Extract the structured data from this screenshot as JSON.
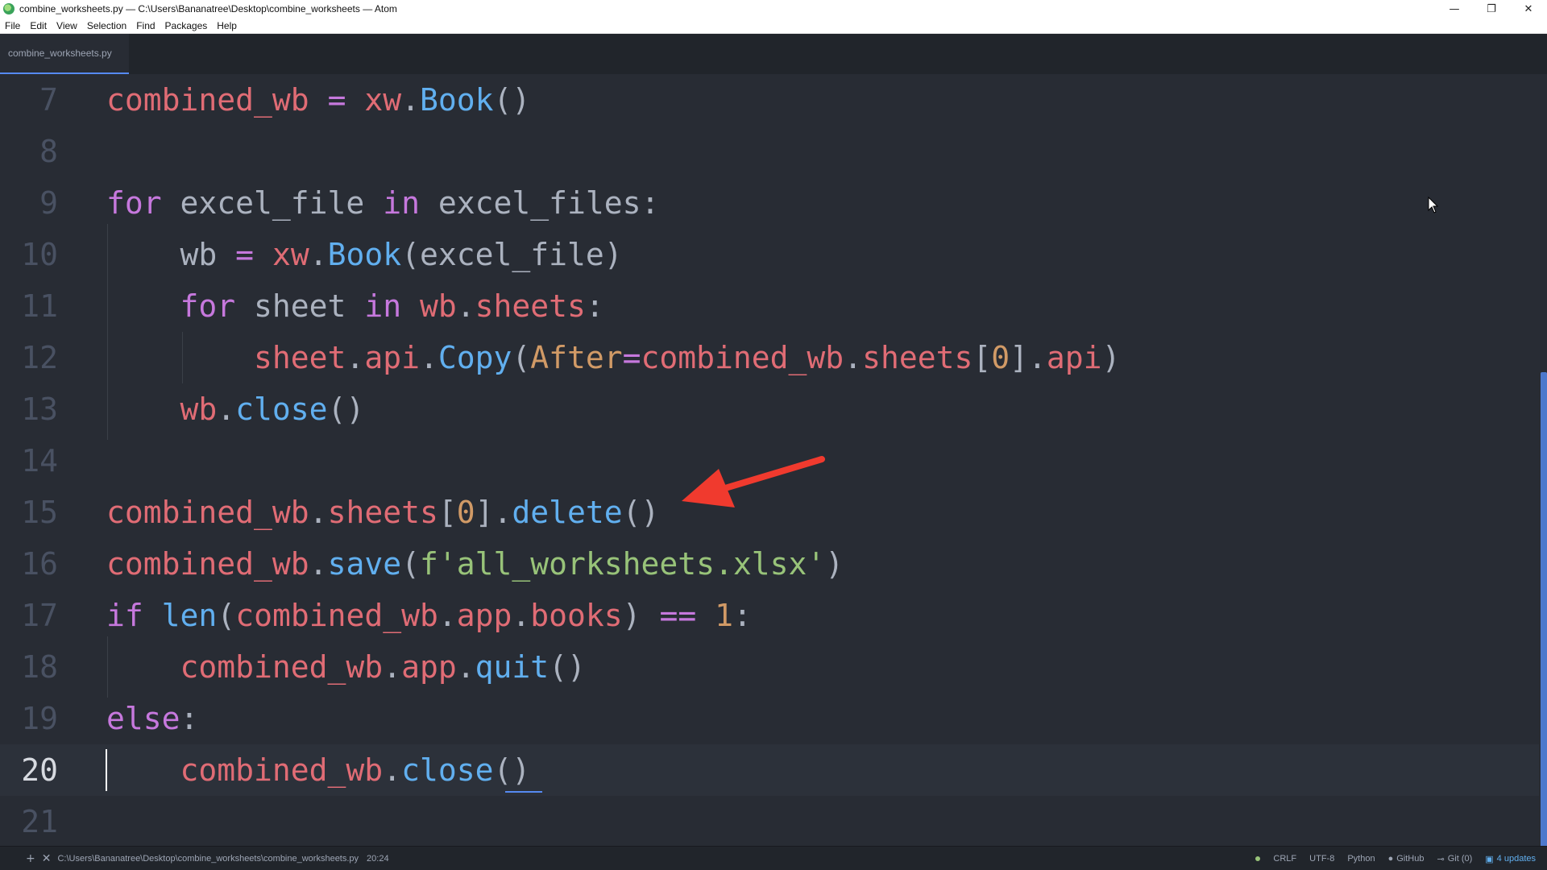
{
  "window": {
    "title": "combine_worksheets.py — C:\\Users\\Bananatree\\Desktop\\combine_worksheets — Atom",
    "minimize": "—",
    "restore": "❐",
    "close": "✕"
  },
  "menu": [
    "File",
    "Edit",
    "View",
    "Selection",
    "Find",
    "Packages",
    "Help"
  ],
  "tab": {
    "label": "combine_worksheets.py"
  },
  "editor": {
    "line_numbers": [
      "7",
      "8",
      "9",
      "10",
      "11",
      "12",
      "13",
      "14",
      "15",
      "16",
      "17",
      "18",
      "19",
      "20",
      "21"
    ],
    "active_line": "20",
    "code_tokens": {
      "l7": [
        [
          "var",
          "combined_wb"
        ],
        [
          "pl",
          " "
        ],
        [
          "op",
          "="
        ],
        [
          "pl",
          " "
        ],
        [
          "var",
          "xw"
        ],
        [
          "pl",
          "."
        ],
        [
          "fn",
          "Book"
        ],
        [
          "pl",
          "()"
        ]
      ],
      "l8": [],
      "l9": [
        [
          "kw",
          "for"
        ],
        [
          "pl",
          " excel_file "
        ],
        [
          "kw",
          "in"
        ],
        [
          "pl",
          " excel_files:"
        ]
      ],
      "l10": [
        [
          "pl",
          "    wb "
        ],
        [
          "op",
          "="
        ],
        [
          "pl",
          " "
        ],
        [
          "var",
          "xw"
        ],
        [
          "pl",
          "."
        ],
        [
          "fn",
          "Book"
        ],
        [
          "pl",
          "(excel_file)"
        ]
      ],
      "l11": [
        [
          "pl",
          "    "
        ],
        [
          "kw",
          "for"
        ],
        [
          "pl",
          " sheet "
        ],
        [
          "kw",
          "in"
        ],
        [
          "pl",
          " "
        ],
        [
          "var",
          "wb"
        ],
        [
          "pl",
          "."
        ],
        [
          "var",
          "sheets"
        ],
        [
          "pl",
          ":"
        ]
      ],
      "l12": [
        [
          "pl",
          "        "
        ],
        [
          "var",
          "sheet"
        ],
        [
          "pl",
          "."
        ],
        [
          "var",
          "api"
        ],
        [
          "pl",
          "."
        ],
        [
          "fn",
          "Copy"
        ],
        [
          "pl",
          "("
        ],
        [
          "param",
          "After"
        ],
        [
          "op",
          "="
        ],
        [
          "var",
          "combined_wb"
        ],
        [
          "pl",
          "."
        ],
        [
          "var",
          "sheets"
        ],
        [
          "pl",
          "["
        ],
        [
          "num",
          "0"
        ],
        [
          "pl",
          "]."
        ],
        [
          "var",
          "api"
        ],
        [
          "pl",
          ")"
        ]
      ],
      "l13": [
        [
          "pl",
          "    "
        ],
        [
          "var",
          "wb"
        ],
        [
          "pl",
          "."
        ],
        [
          "fn",
          "close"
        ],
        [
          "pl",
          "()"
        ]
      ],
      "l14": [],
      "l15": [
        [
          "var",
          "combined_wb"
        ],
        [
          "pl",
          "."
        ],
        [
          "var",
          "sheets"
        ],
        [
          "pl",
          "["
        ],
        [
          "num",
          "0"
        ],
        [
          "pl",
          "]."
        ],
        [
          "fn",
          "delete"
        ],
        [
          "pl",
          "()"
        ]
      ],
      "l16": [
        [
          "var",
          "combined_wb"
        ],
        [
          "pl",
          "."
        ],
        [
          "fn",
          "save"
        ],
        [
          "pl",
          "("
        ],
        [
          "str",
          "f'all_worksheets.xlsx'"
        ],
        [
          "pl",
          ")"
        ]
      ],
      "l17": [
        [
          "kw",
          "if"
        ],
        [
          "pl",
          " "
        ],
        [
          "fn",
          "len"
        ],
        [
          "pl",
          "("
        ],
        [
          "var",
          "combined_wb"
        ],
        [
          "pl",
          "."
        ],
        [
          "var",
          "app"
        ],
        [
          "pl",
          "."
        ],
        [
          "var",
          "books"
        ],
        [
          "pl",
          ") "
        ],
        [
          "op",
          "=="
        ],
        [
          "pl",
          " "
        ],
        [
          "num",
          "1"
        ],
        [
          "pl",
          ":"
        ]
      ],
      "l18": [
        [
          "pl",
          "    "
        ],
        [
          "var",
          "combined_wb"
        ],
        [
          "pl",
          "."
        ],
        [
          "var",
          "app"
        ],
        [
          "pl",
          "."
        ],
        [
          "fn",
          "quit"
        ],
        [
          "pl",
          "()"
        ]
      ],
      "l19": [
        [
          "kw",
          "else"
        ],
        [
          "pl",
          ":"
        ]
      ],
      "l20": [
        [
          "pl",
          "    "
        ],
        [
          "var",
          "combined_wb"
        ],
        [
          "pl",
          "."
        ],
        [
          "fn",
          "close"
        ],
        [
          "pl",
          "()"
        ]
      ],
      "l21": []
    }
  },
  "annotation": {
    "arrow_color": "#f03a2e"
  },
  "statusbar": {
    "add_icon": "+",
    "close_icon": "✕",
    "file_path": "C:\\Users\\Bananatree\\Desktop\\combine_worksheets\\combine_worksheets.py",
    "cursor_position": "20:24",
    "line_ending": "CRLF",
    "encoding": "UTF-8",
    "grammar": "Python",
    "github": "GitHub",
    "git": "Git (0)",
    "updates": "4 updates"
  },
  "colors": {
    "editor_bg": "#282c34",
    "keyword": "#c678dd",
    "variable": "#e06c75",
    "function": "#61afef",
    "string": "#98c379",
    "number": "#d19a66",
    "accent": "#568af2"
  }
}
